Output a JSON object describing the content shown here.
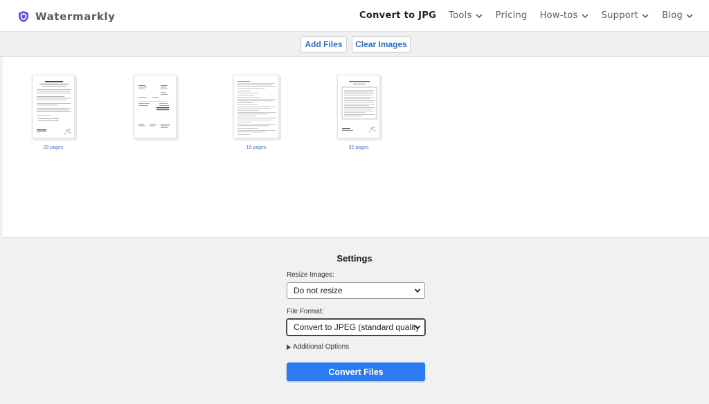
{
  "brand": {
    "name": "Watermarkly",
    "logo_icon": "shield-icon",
    "logo_color": "#6b4de6"
  },
  "nav": {
    "items": [
      {
        "label": "Convert to JPG",
        "active": true,
        "dropdown": false
      },
      {
        "label": "Tools",
        "active": false,
        "dropdown": true
      },
      {
        "label": "Pricing",
        "active": false,
        "dropdown": false
      },
      {
        "label": "How-tos",
        "active": false,
        "dropdown": true
      },
      {
        "label": "Support",
        "active": false,
        "dropdown": true
      },
      {
        "label": "Blog",
        "active": false,
        "dropdown": true
      }
    ]
  },
  "toolbar": {
    "add_files_label": "Add Files",
    "clear_images_label": "Clear Images"
  },
  "files": [
    {
      "pages_label": "29 pages"
    },
    {
      "pages_label": ""
    },
    {
      "pages_label": "10 pages"
    },
    {
      "pages_label": "32 pages"
    }
  ],
  "settings": {
    "title": "Settings",
    "resize_label": "Resize Images:",
    "resize_value": "Do not resize",
    "format_label": "File Format:",
    "format_value": "Convert to JPEG (standard quality, r",
    "additional_options_label": "Additional Options",
    "convert_label": "Convert Files"
  },
  "colors": {
    "accent": "#2d7bf0",
    "link": "#2f6fba"
  }
}
